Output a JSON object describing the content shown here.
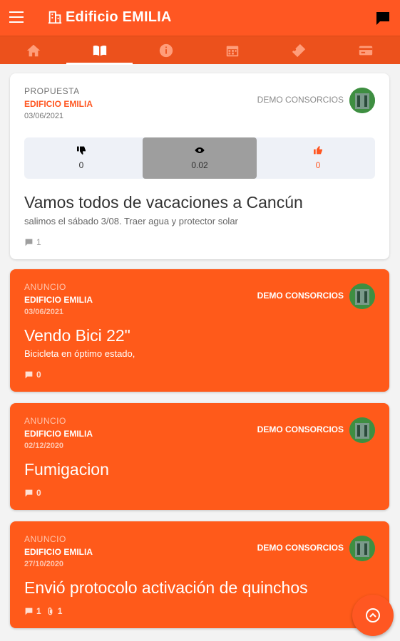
{
  "app": {
    "title": "Edificio EMILIA"
  },
  "icons": {
    "menu": "menu-icon",
    "building": "building-icon",
    "chat": "chat-icon",
    "tabs": [
      "home-icon",
      "book-icon",
      "info-icon",
      "calendar-icon",
      "ticket-icon",
      "card-icon"
    ],
    "fab": "arrow-up-circle-icon"
  },
  "colors": {
    "primary": "#ff5722",
    "tab_bar": "#ec511c",
    "card_orange": "#ff5a1a",
    "vote_bg": "#eef1f7",
    "vote_selected": "#9e9e9e"
  },
  "active_tab": 1,
  "posts": [
    {
      "style": "white",
      "category": "PROPUESTA",
      "building": "EDIFICIO EMILIA",
      "date": "03/06/2021",
      "author": "DEMO CONSORCIOS",
      "votes": {
        "down": "0",
        "views": "0.02",
        "up": "0"
      },
      "title": "Vamos todos de vacaciones a Cancún",
      "description": "salimos el sábado 3/08. Traer agua y protector solar",
      "comments": "1"
    },
    {
      "style": "orange",
      "category": "ANUNCIO",
      "building": "EDIFICIO EMILIA",
      "date": "03/06/2021",
      "author": "DEMO CONSORCIOS",
      "title": "Vendo Bici 22\"",
      "description": "Bicicleta en óptimo estado,",
      "comments": "0"
    },
    {
      "style": "orange",
      "category": "ANUNCIO",
      "building": "EDIFICIO EMILIA",
      "date": "02/12/2020",
      "author": "DEMO CONSORCIOS",
      "title": "Fumigacion",
      "comments": "0"
    },
    {
      "style": "orange",
      "category": "ANUNCIO",
      "building": "EDIFICIO EMILIA",
      "date": "27/10/2020",
      "author": "DEMO CONSORCIOS",
      "title": "Envió protocolo activación de quinchos",
      "comments": "1",
      "attachments": "1"
    }
  ]
}
